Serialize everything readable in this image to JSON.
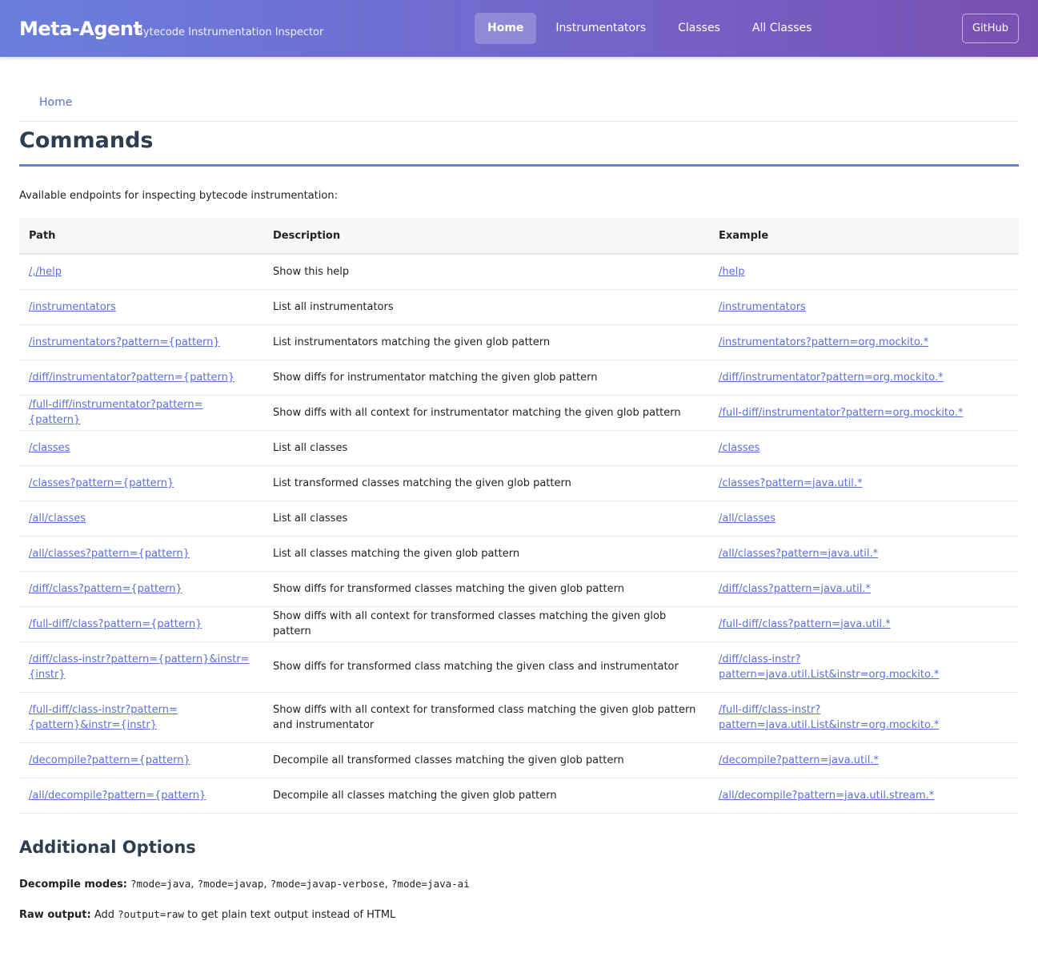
{
  "header": {
    "brand": "Meta-Agent",
    "tagline": "Bytecode Instrumentation Inspector",
    "nav": [
      {
        "label": "Home",
        "active": true
      },
      {
        "label": "Instrumentators",
        "active": false
      },
      {
        "label": "Classes",
        "active": false
      },
      {
        "label": "All Classes",
        "active": false
      }
    ],
    "github_label": "GitHub"
  },
  "breadcrumb": {
    "home": "Home"
  },
  "page": {
    "title": "Commands",
    "intro": "Available endpoints for inspecting bytecode instrumentation:"
  },
  "table": {
    "headers": {
      "path": "Path",
      "description": "Description",
      "example": "Example"
    },
    "rows": [
      {
        "path": "/,/help",
        "description": "Show this help",
        "example": "/help"
      },
      {
        "path": "/instrumentators",
        "description": "List all instrumentators",
        "example": "/instrumentators"
      },
      {
        "path": "/instrumentators?pattern={pattern}",
        "description": "List instrumentators matching the given glob pattern",
        "example": "/instrumentators?pattern=org.mockito.*"
      },
      {
        "path": "/diff/instrumentator?pattern={pattern}",
        "description": "Show diffs for instrumentator matching the given glob pattern",
        "example": "/diff/instrumentator?pattern=org.mockito.*"
      },
      {
        "path": "/full-diff/instrumentator?pattern={pattern}",
        "description": "Show diffs with all context for instrumentator matching the given glob pattern",
        "example": "/full-diff/instrumentator?pattern=org.mockito.*"
      },
      {
        "path": "/classes",
        "description": "List all classes",
        "example": "/classes"
      },
      {
        "path": "/classes?pattern={pattern}",
        "description": "List transformed classes matching the given glob pattern",
        "example": "/classes?pattern=java.util.*"
      },
      {
        "path": "/all/classes",
        "description": "List all classes",
        "example": "/all/classes"
      },
      {
        "path": "/all/classes?pattern={pattern}",
        "description": "List all classes matching the given glob pattern",
        "example": "/all/classes?pattern=java.util.*"
      },
      {
        "path": "/diff/class?pattern={pattern}",
        "description": "Show diffs for transformed classes matching the given glob pattern",
        "example": "/diff/class?pattern=java.util.*"
      },
      {
        "path": "/full-diff/class?pattern={pattern}",
        "description": "Show diffs with all context for transformed classes matching the given glob pattern",
        "example": "/full-diff/class?pattern=java.util.*"
      },
      {
        "path": "/diff/class-instr?pattern={pattern}&instr={instr}",
        "description": "Show diffs for transformed class matching the given class and instrumentator",
        "example": "/diff/class-instr?pattern=java.util.List&instr=org.mockito.*"
      },
      {
        "path": "/full-diff/class-instr?pattern={pattern}&instr={instr}",
        "description": "Show diffs with all context for transformed class matching the given glob pattern and instrumentator",
        "example": "/full-diff/class-instr?pattern=java.util.List&instr=org.mockito.*"
      },
      {
        "path": "/decompile?pattern={pattern}",
        "description": "Decompile all transformed classes matching the given glob pattern",
        "example": "/decompile?pattern=java.util.*"
      },
      {
        "path": "/all/decompile?pattern={pattern}",
        "description": "Decompile all classes matching the given glob pattern",
        "example": "/all/decompile?pattern=java.util.stream.*"
      }
    ]
  },
  "options": {
    "title": "Additional Options",
    "decompile_label": "Decompile modes:",
    "modes": [
      "?mode=java",
      "?mode=javap",
      "?mode=javap-verbose",
      "?mode=java-ai"
    ],
    "raw_label": "Raw output:",
    "raw_prefix": "Add",
    "raw_code": "?output=raw",
    "raw_suffix": "to get plain text output instead of HTML"
  }
}
